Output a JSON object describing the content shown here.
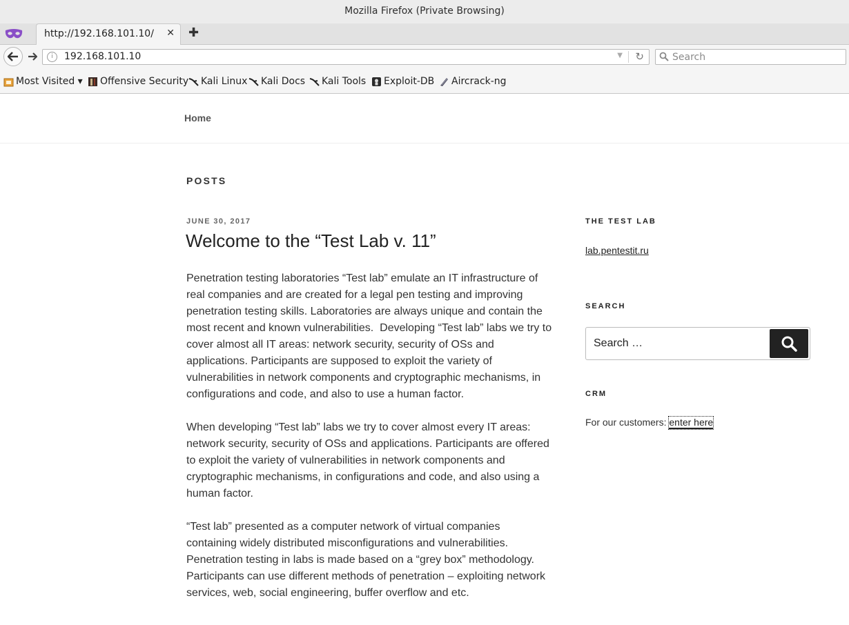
{
  "window": {
    "title": "Mozilla Firefox (Private Browsing)"
  },
  "tab": {
    "title": "http://192.168.101.10/"
  },
  "navbar": {
    "url": "192.168.101.10",
    "search_placeholder": "Search"
  },
  "bookmarks": [
    {
      "label": "Most Visited ▾"
    },
    {
      "label": "Offensive Security"
    },
    {
      "label": "Kali Linux"
    },
    {
      "label": "Kali Docs"
    },
    {
      "label": "Kali Tools"
    },
    {
      "label": "Exploit-DB"
    },
    {
      "label": "Aircrack-ng"
    }
  ],
  "site": {
    "nav_home": "Home"
  },
  "page": {
    "heading": "POSTS"
  },
  "post": {
    "date": "JUNE 30, 2017",
    "title": "Welcome to the “Test Lab v. 11”",
    "paragraphs": [
      "Penetration testing laboratories “Test lab” emulate an IT infrastructure of real companies and are created for a legal pen testing and improving penetration testing skills. Laboratories are always unique and contain the most recent and known vulnerabilities.  Developing “Test lab” labs we try to cover almost all IT areas: network security, security of OSs and applications. Participants are supposed to exploit the variety of vulnerabilities in network components and cryptographic mechanisms, in configurations and code, and also to use a human factor.",
      "When developing “Test lab” labs we try to cover almost every IT areas: network security, security of OSs and applications. Participants are offered to exploit the variety of vulnerabilities in network components and cryptographic mechanisms, in configurations and code, and also using a human factor.",
      "“Test lab” presented as a computer network of virtual companies containing widely distributed misconfigurations and vulnerabilities. Penetration testing in labs is made based on a “grey box” methodology. Participants can use different methods of penetration – exploiting network services, web, social engineering, buffer overflow and etc."
    ]
  },
  "sidebar": {
    "testlab": {
      "title": "THE TEST LAB",
      "link": "lab.pentestit.ru"
    },
    "search": {
      "title": "SEARCH",
      "placeholder": "Search …"
    },
    "crm": {
      "title": "CRM",
      "text": "For our customers: ",
      "link": "enter here"
    }
  }
}
